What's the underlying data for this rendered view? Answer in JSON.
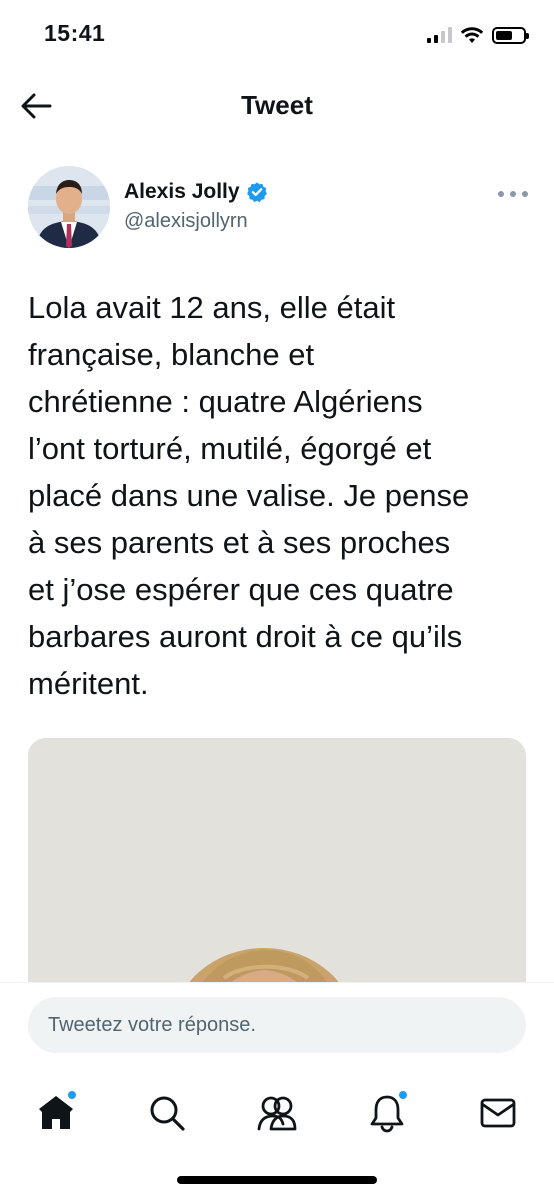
{
  "status_bar": {
    "time": "15:41"
  },
  "header": {
    "title": "Tweet",
    "back_icon": "arrow-left-icon"
  },
  "tweet": {
    "author": {
      "name": "Alexis Jolly",
      "handle": "@alexisjollyrn",
      "verified": true
    },
    "text": "Lola avait 12 ans, elle était\nfrançaise, blanche et\nchrétienne : quatre Algériens\nl’ont torturé, mutilé, égorgé et\nplacé dans une valise. Je pense\nà ses parents et à ses proches\net j’ose espérer que ces quatre\nbarbares auront droit à ce qu’ils\nméritent."
  },
  "reply": {
    "placeholder": "Tweetez votre réponse."
  },
  "bottom_nav": {
    "items": [
      {
        "icon": "home-icon",
        "badge": true
      },
      {
        "icon": "search-icon",
        "badge": false
      },
      {
        "icon": "communities-icon",
        "badge": false
      },
      {
        "icon": "notifications-bell-icon",
        "badge": true
      },
      {
        "icon": "messages-envelope-icon",
        "badge": false
      }
    ]
  },
  "colors": {
    "accent": "#1d9bf0",
    "text_primary": "#0f1419",
    "text_secondary": "#536471",
    "input_background": "#eff3f4"
  }
}
